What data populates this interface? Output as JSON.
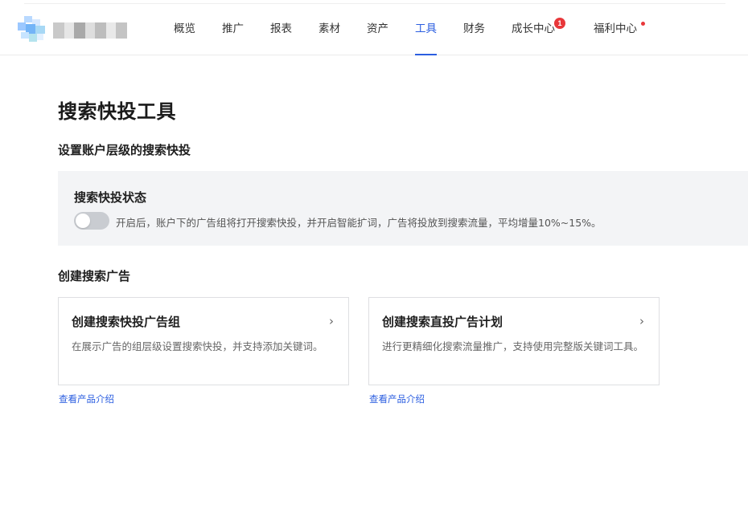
{
  "header": {
    "nav": [
      {
        "label": "概览"
      },
      {
        "label": "推广"
      },
      {
        "label": "报表"
      },
      {
        "label": "素材"
      },
      {
        "label": "资产"
      },
      {
        "label": "工具",
        "active": true
      },
      {
        "label": "财务"
      },
      {
        "label": "成长中心",
        "badge": "1"
      },
      {
        "label": "福利中心",
        "dot": true
      }
    ],
    "accent_color": "#2b5ee0",
    "badge_color": "#e8373a"
  },
  "page": {
    "title": "搜索快投工具",
    "account_section_title": "设置账户层级的搜索快投",
    "status_panel": {
      "title": "搜索快投状态",
      "toggle_on": false,
      "description": "开启后，账户下的广告组将打开搜索快投，并开启智能扩词，广告将投放到搜索流量，平均增量10%~15%。"
    },
    "create_section_title": "创建搜索广告",
    "cards": [
      {
        "title": "创建搜索快投广告组",
        "chevron": "›",
        "description": "在展示广告的组层级设置搜索快投，并支持添加关键词。",
        "link": "查看产品介绍"
      },
      {
        "title": "创建搜索直投广告计划",
        "chevron": "›",
        "description": "进行更精细化搜索流量推广，支持使用完整版关键词工具。",
        "link": "查看产品介绍"
      }
    ]
  }
}
